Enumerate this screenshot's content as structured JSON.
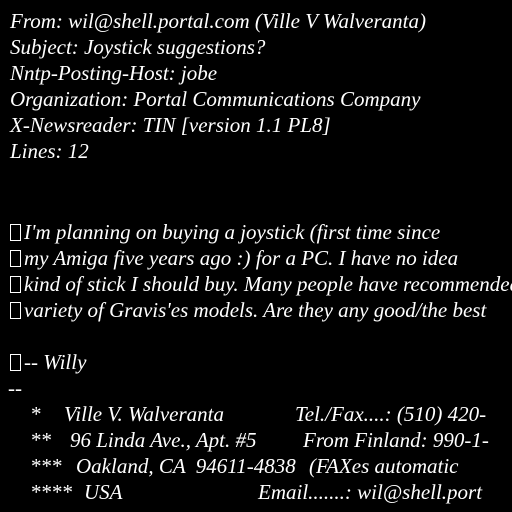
{
  "headers": {
    "from": "From: wil@shell.portal.com (Ville V Walveranta)",
    "subject": "Subject: Joystick suggestions?",
    "host": "Nntp-Posting-Host: jobe",
    "organization": "Organization: Portal Communications Company",
    "newsreader": "X-Newsreader: TIN [version 1.1 PL8]",
    "lines": "Lines: 12"
  },
  "body": [
    "I'm planning on buying a joystick (first time since",
    "my Amiga five years ago :) for a PC. I have no idea",
    "kind of stick I should buy. Many people have recommended",
    "variety of Gravis'es models. Are they any good/the best"
  ],
  "closing": "-- Willy",
  "separator": "--",
  "signature": [
    {
      "mark": "*",
      "left": "Ville V. Walveranta",
      "right": "Tel./Fax....: (510) 420-"
    },
    {
      "mark": "**",
      "left": "96 Linda Ave., Apt. #5",
      "right": "From Finland: 990-1-"
    },
    {
      "mark": "***",
      "left": "Oakland, CA  94611-4838",
      "right": "(FAXes automatic"
    },
    {
      "mark": "****",
      "left": "USA",
      "right": "Email.......: wil@shell.port"
    }
  ]
}
